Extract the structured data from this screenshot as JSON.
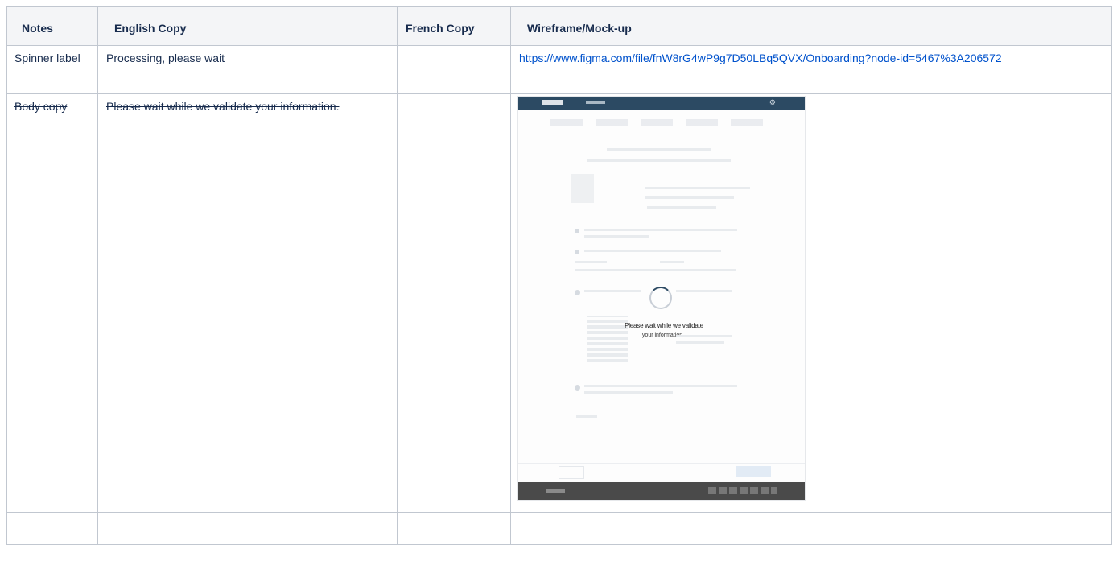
{
  "table": {
    "headers": [
      "Notes",
      "English Copy",
      "French Copy",
      "Wireframe/Mock-up"
    ],
    "rows": [
      {
        "notes": "Spinner label",
        "english": "Processing, please wait",
        "french": "",
        "wireframe_link": "https://www.figma.com/file/fnW8rG4wP9g7D50LBq5QVX/Onboarding?node-id=5467%3A206572"
      },
      {
        "notes": "Body copy",
        "english": "Please wait while we validate your information.",
        "french": "",
        "mockup": {
          "overlay_title": "Please wait while we validate",
          "overlay_subtitle": "your information."
        }
      },
      {
        "notes": "",
        "english": "",
        "french": "",
        "wireframe": ""
      }
    ]
  },
  "icons": {
    "settings": "gear-icon",
    "spinner": "spinner-icon"
  },
  "colors": {
    "link": "#0052cc",
    "header_bg": "#f4f5f7",
    "border": "#c1c7d0",
    "mock_topbar": "#2c4a63",
    "mock_footer": "#4a4a4a"
  }
}
